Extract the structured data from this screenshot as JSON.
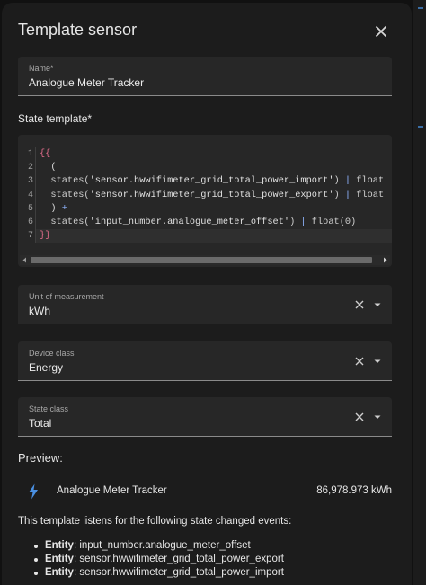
{
  "dialog": {
    "title": "Template sensor"
  },
  "name_field": {
    "label": "Name*",
    "value": "Analogue Meter Tracker"
  },
  "state_template": {
    "label": "State template*",
    "line_numbers": [
      "1",
      "2",
      "3",
      "4",
      "5",
      "6",
      "7"
    ],
    "lines": [
      [
        {
          "t": "{{",
          "c": "br"
        }
      ],
      [
        {
          "t": "  (",
          "c": "tx"
        }
      ],
      [
        {
          "t": "  states(",
          "c": "fn"
        },
        {
          "t": "'sensor.hwwifimeter_grid_total_power_import'",
          "c": "sq"
        },
        {
          "t": ") ",
          "c": "fn"
        },
        {
          "t": "|",
          "c": "op"
        },
        {
          "t": " float",
          "c": "fn"
        }
      ],
      [
        {
          "t": "  states(",
          "c": "fn"
        },
        {
          "t": "'sensor.hwwifimeter_grid_total_power_export'",
          "c": "sq"
        },
        {
          "t": ") ",
          "c": "fn"
        },
        {
          "t": "|",
          "c": "op"
        },
        {
          "t": " float",
          "c": "fn"
        }
      ],
      [
        {
          "t": "  ) ",
          "c": "tx"
        },
        {
          "t": "+",
          "c": "op"
        }
      ],
      [
        {
          "t": "  states(",
          "c": "fn"
        },
        {
          "t": "'input_number.analogue_meter_offset'",
          "c": "sq"
        },
        {
          "t": ") ",
          "c": "fn"
        },
        {
          "t": "|",
          "c": "op"
        },
        {
          "t": " float(0)",
          "c": "fn"
        }
      ],
      [
        {
          "t": "}}",
          "c": "br"
        }
      ]
    ]
  },
  "unit_field": {
    "label": "Unit of measurement",
    "value": "kWh"
  },
  "device_class_field": {
    "label": "Device class",
    "value": "Energy"
  },
  "state_class_field": {
    "label": "State class",
    "value": "Total"
  },
  "preview": {
    "title": "Preview:",
    "entity_name": "Analogue Meter Tracker",
    "entity_value": "86,978.973 kWh",
    "icon": "lightning-bolt-icon",
    "listen_text": "This template listens for the following state changed events:",
    "entity_key": "Entity",
    "entities": [
      "input_number.analogue_meter_offset",
      "sensor.hwwifimeter_grid_total_power_export",
      "sensor.hwwifimeter_grid_total_power_import"
    ]
  },
  "colors": {
    "surface": "#1c1c1c",
    "field_bg": "#272727",
    "accent_blue": "#4a90e2",
    "brace": "#e06c8a"
  }
}
